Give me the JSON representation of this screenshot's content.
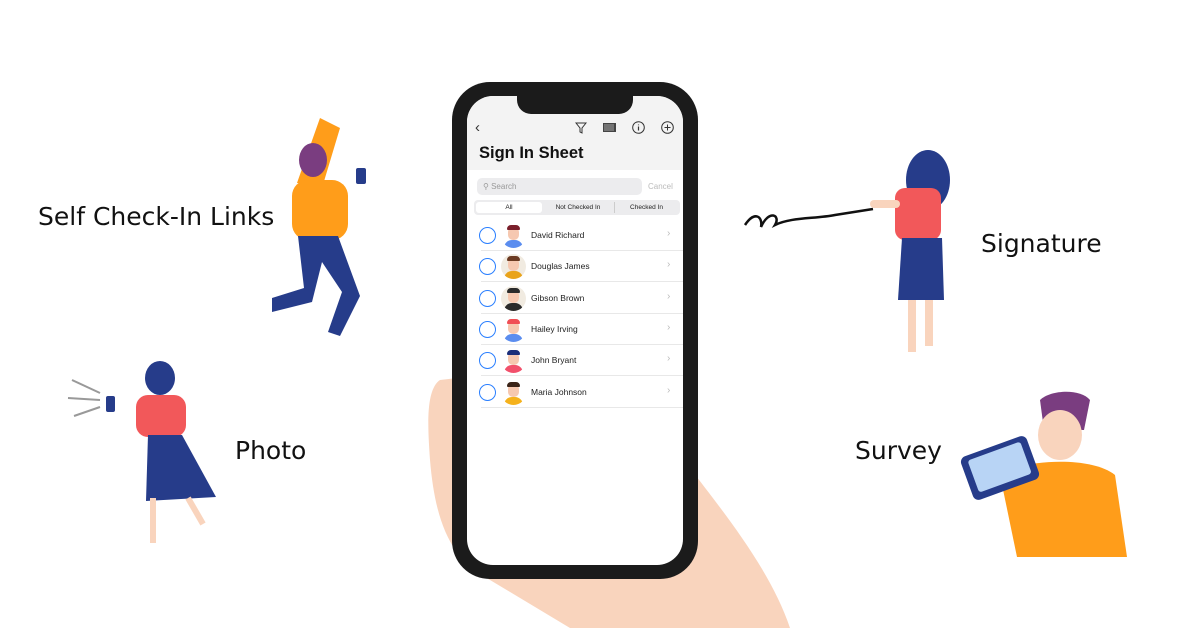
{
  "features": {
    "self_checkin": "Self Check-In Links",
    "photo": "Photo",
    "signature": "Signature",
    "survey": "Survey"
  },
  "app": {
    "title": "Sign In Sheet",
    "search": {
      "placeholder": "Search",
      "cancel": "Cancel"
    },
    "tabs": [
      {
        "label": "All",
        "selected": true
      },
      {
        "label": "Not Checked In"
      },
      {
        "label": "Checked In"
      }
    ],
    "icons": [
      "back-chevron-icon",
      "filter-icon",
      "barcode-scanner-icon",
      "info-icon",
      "add-icon"
    ],
    "attendees": [
      {
        "name": "David Richard",
        "checked": false,
        "hair": "#7a1f2b",
        "shirt": "#5b8def"
      },
      {
        "name": "Douglas James",
        "checked": false,
        "hair": "#6b3a22",
        "shirt": "#e9a31a"
      },
      {
        "name": "Gibson Brown",
        "checked": false,
        "hair": "#2a2a2a",
        "shirt": "#2a2a2a"
      },
      {
        "name": "Hailey Irving",
        "checked": false,
        "hair": "#f04e55",
        "shirt": "#5b8def"
      },
      {
        "name": "John Bryant",
        "checked": false,
        "hair": "#1c2f7a",
        "shirt": "#f2506b"
      },
      {
        "name": "Maria Johnson",
        "checked": false,
        "hair": "#3a2418",
        "shirt": "#f5b21c"
      }
    ]
  },
  "colors": {
    "accent": "#2a7fff",
    "skin": "#f9d4bd",
    "orange": "#ff9d1a",
    "navy": "#263c8a",
    "coral": "#f2585a"
  }
}
